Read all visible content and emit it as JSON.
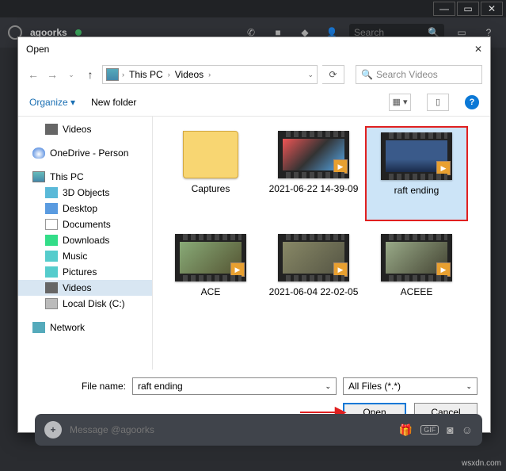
{
  "app": {
    "username": "agoorks",
    "search_placeholder": "Search",
    "message_placeholder": "Message @agoorks"
  },
  "dialog": {
    "title": "Open",
    "path": {
      "root": "This PC",
      "folder": "Videos"
    },
    "search_placeholder": "Search Videos",
    "toolbar": {
      "organize": "Organize",
      "newfolder": "New folder"
    },
    "tree": {
      "videos": "Videos",
      "onedrive": "OneDrive - Person",
      "thispc": "This PC",
      "objects": "3D Objects",
      "desktop": "Desktop",
      "documents": "Documents",
      "downloads": "Downloads",
      "music": "Music",
      "pictures": "Pictures",
      "videos2": "Videos",
      "localdisk": "Local Disk (C:)",
      "network": "Network"
    },
    "files": [
      {
        "name": "Captures"
      },
      {
        "name": "2021-06-22 14-39-09"
      },
      {
        "name": "raft ending"
      },
      {
        "name": "ACE"
      },
      {
        "name": "2021-06-04 22-02-05"
      },
      {
        "name": "ACEEE"
      }
    ],
    "filename_label": "File name:",
    "filename_value": "raft ending",
    "filter": "All Files (*.*)",
    "open": "Open",
    "cancel": "Cancel"
  },
  "watermark": "wsxdn.com"
}
